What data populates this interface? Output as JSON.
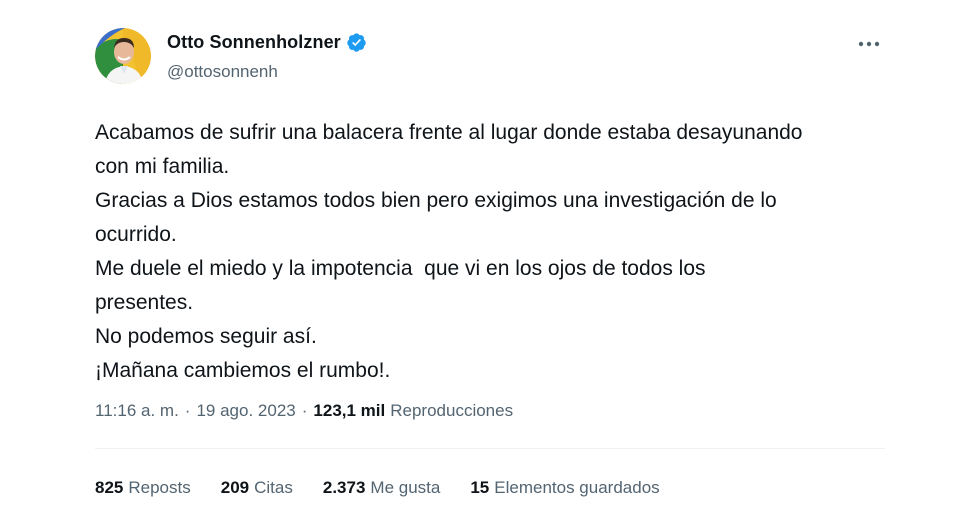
{
  "author": {
    "display_name": "Otto Sonnenholzner",
    "handle": "@ottosonnenh",
    "verified": true,
    "verified_color": "#1d9bf0"
  },
  "tweet": {
    "lines": [
      "Acabamos de sufrir una balacera frente al lugar donde estaba desayunando",
      "con mi familia.",
      "Gracias a Dios estamos todos bien pero exigimos una investigación de lo",
      "ocurrido.",
      "Me duele el miedo y la impotencia  que vi en los ojos de todos los",
      "presentes.",
      "No podemos seguir así.",
      "¡Mañana cambiemos el rumbo!."
    ]
  },
  "meta": {
    "time": "11:16 a. m.",
    "separator": "·",
    "date": "19 ago. 2023",
    "views_count": "123,1 mil",
    "views_label": "Reproducciones"
  },
  "stats": {
    "reposts_count": "825",
    "reposts_label": "Reposts",
    "quotes_count": "209",
    "quotes_label": "Citas",
    "likes_count": "2.373",
    "likes_label": "Me gusta",
    "bookmarks_count": "15",
    "bookmarks_label": "Elementos guardados"
  },
  "icons": {
    "verified": "verified-badge-icon",
    "more": "more-options-icon"
  }
}
